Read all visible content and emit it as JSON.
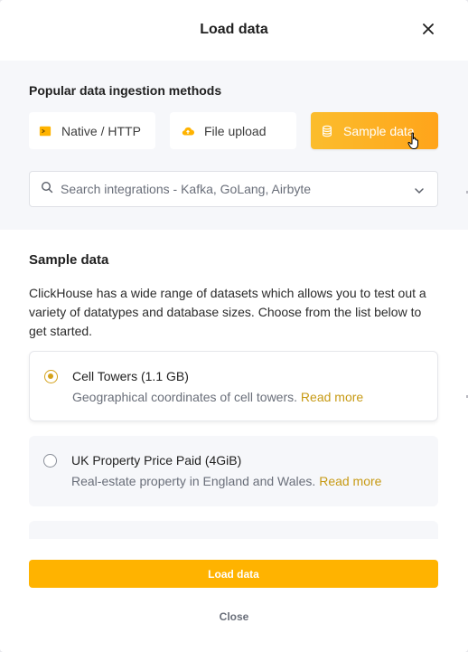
{
  "dialog": {
    "title": "Load data"
  },
  "ingestion": {
    "title": "Popular data ingestion methods",
    "methods": [
      {
        "label": "Native / HTTP",
        "icon": "terminal-icon",
        "selected": false
      },
      {
        "label": "File upload",
        "icon": "cloud-upload-icon",
        "selected": false
      },
      {
        "label": "Sample data",
        "icon": "database-icon",
        "selected": true
      }
    ],
    "search_placeholder": "Search integrations - Kafka, GoLang, Airbyte"
  },
  "sample": {
    "title": "Sample data",
    "description": "ClickHouse has a wide range of datasets which allows you to test out a variety of datatypes and database sizes. Choose from the list below to get started.",
    "datasets": [
      {
        "title": "Cell Towers (1.1 GB)",
        "description": "Geographical coordinates of cell towers.",
        "link": "Read more",
        "selected": true
      },
      {
        "title": "UK Property Price Paid (4GiB)",
        "description": "Real-estate property in England and Wales.",
        "link": "Read more",
        "selected": false
      }
    ]
  },
  "footer": {
    "primary": "Load data",
    "secondary": "Close"
  },
  "colors": {
    "accent": "#ffb300",
    "link": "#c79a14",
    "panel_bg": "#f6f7fa"
  }
}
